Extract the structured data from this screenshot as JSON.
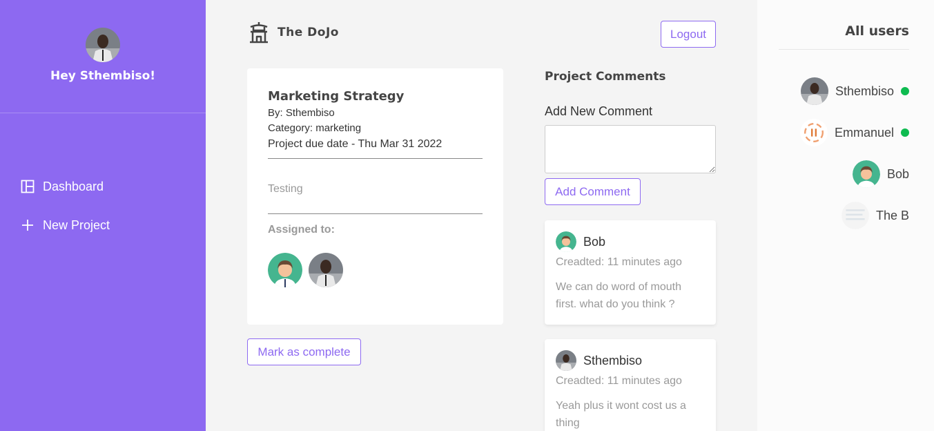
{
  "sidebar": {
    "greeting": "Hey Sthembiso!",
    "nav": [
      {
        "label": "Dashboard",
        "icon": "dashboard-icon"
      },
      {
        "label": "New Project",
        "icon": "plus-icon"
      }
    ]
  },
  "header": {
    "brand": "The DoJo",
    "logout": "Logout"
  },
  "project": {
    "title": "Marketing Strategy",
    "by": "By: Sthembiso",
    "category": "Category: marketing",
    "due": "Project due date - Thu Mar 31 2022",
    "description": "Testing",
    "assigned_label": "Assigned to:",
    "mark_complete": "Mark as complete"
  },
  "comments": {
    "heading": "Project Comments",
    "add_label": "Add New Comment",
    "add_button": "Add Comment",
    "items": [
      {
        "author": "Bob",
        "time": "Creadted: 11 minutes ago",
        "text": "We can do word of mouth first. what do you think ?"
      },
      {
        "author": "Sthembiso",
        "time": "Creadted: 11 minutes ago",
        "text": "Yeah plus it wont cost us a thing"
      }
    ]
  },
  "users": {
    "heading": "All users",
    "list": [
      {
        "name": "Sthembiso",
        "online": true
      },
      {
        "name": "Emmanuel",
        "online": true
      },
      {
        "name": "Bob",
        "online": false
      },
      {
        "name": "The B",
        "online": false
      }
    ]
  },
  "colors": {
    "accent": "#8d69f1",
    "online": "#0ebb50",
    "background": "#f4f4f4"
  }
}
